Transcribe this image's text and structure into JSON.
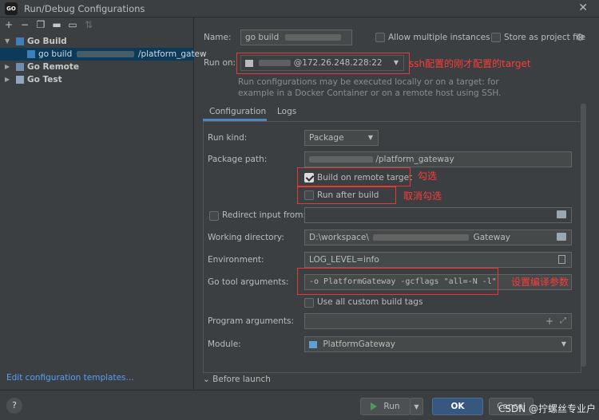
{
  "window": {
    "title": "Run/Debug Configurations",
    "icon_text": "GO"
  },
  "toolbar": {
    "icons": [
      "add-icon",
      "remove-icon",
      "copy-icon",
      "save-icon",
      "folder-icon",
      "sort-icon"
    ]
  },
  "tree": {
    "go_build": "Go Build",
    "go_build_child": "go build",
    "go_build_child_suffix": "/platform_gatew",
    "go_remote": "Go Remote",
    "go_test": "Go Test"
  },
  "edit_templates": "Edit configuration templates...",
  "form": {
    "name_label": "Name:",
    "name_value": "go build",
    "allow_multiple": "Allow multiple instances",
    "store_project": "Store as project file",
    "run_on_label": "Run on:",
    "run_on_value": "@172.26.248.228:22",
    "help_text": "Run configurations may be executed locally or on a target: for example in a Docker Container or on a remote host using SSH.",
    "tab_configuration": "Configuration",
    "tab_logs": "Logs",
    "run_kind_label": "Run kind:",
    "run_kind_value": "Package",
    "package_path_label": "Package path:",
    "package_path_value": "/platform_gateway",
    "build_remote": "Build on remote target",
    "run_after_build": "Run after build",
    "redirect_input": "Redirect input from:",
    "working_dir_label": "Working directory:",
    "working_dir_value": "D:\\workspace\\",
    "working_dir_suffix": "Gateway",
    "env_label": "Environment:",
    "env_value": "LOG_LEVEL=info",
    "go_tool_args_label": "Go tool arguments:",
    "go_tool_args_value": "-o PlatformGateway -gcflags \"all=-N -l\"",
    "use_custom_tags": "Use all custom build tags",
    "program_args_label": "Program arguments:",
    "module_label": "Module:",
    "module_value": "PlatformGateway",
    "before_launch": "Before launch"
  },
  "annotations": {
    "note_run_on": "ssh配置的刚才配置的target",
    "note_build_remote": "勾选",
    "note_run_after": "取消勾选",
    "note_go_tool": "设置编译参数"
  },
  "buttons": {
    "help": "?",
    "run": "Run",
    "ok": "OK",
    "cancel": "Cancel"
  },
  "watermark": "CSDN @拧螺丝专业户",
  "colors": {
    "accent": "#365880",
    "selection": "#0d3a58",
    "annotation_red": "#e53935",
    "link": "#589df6"
  }
}
